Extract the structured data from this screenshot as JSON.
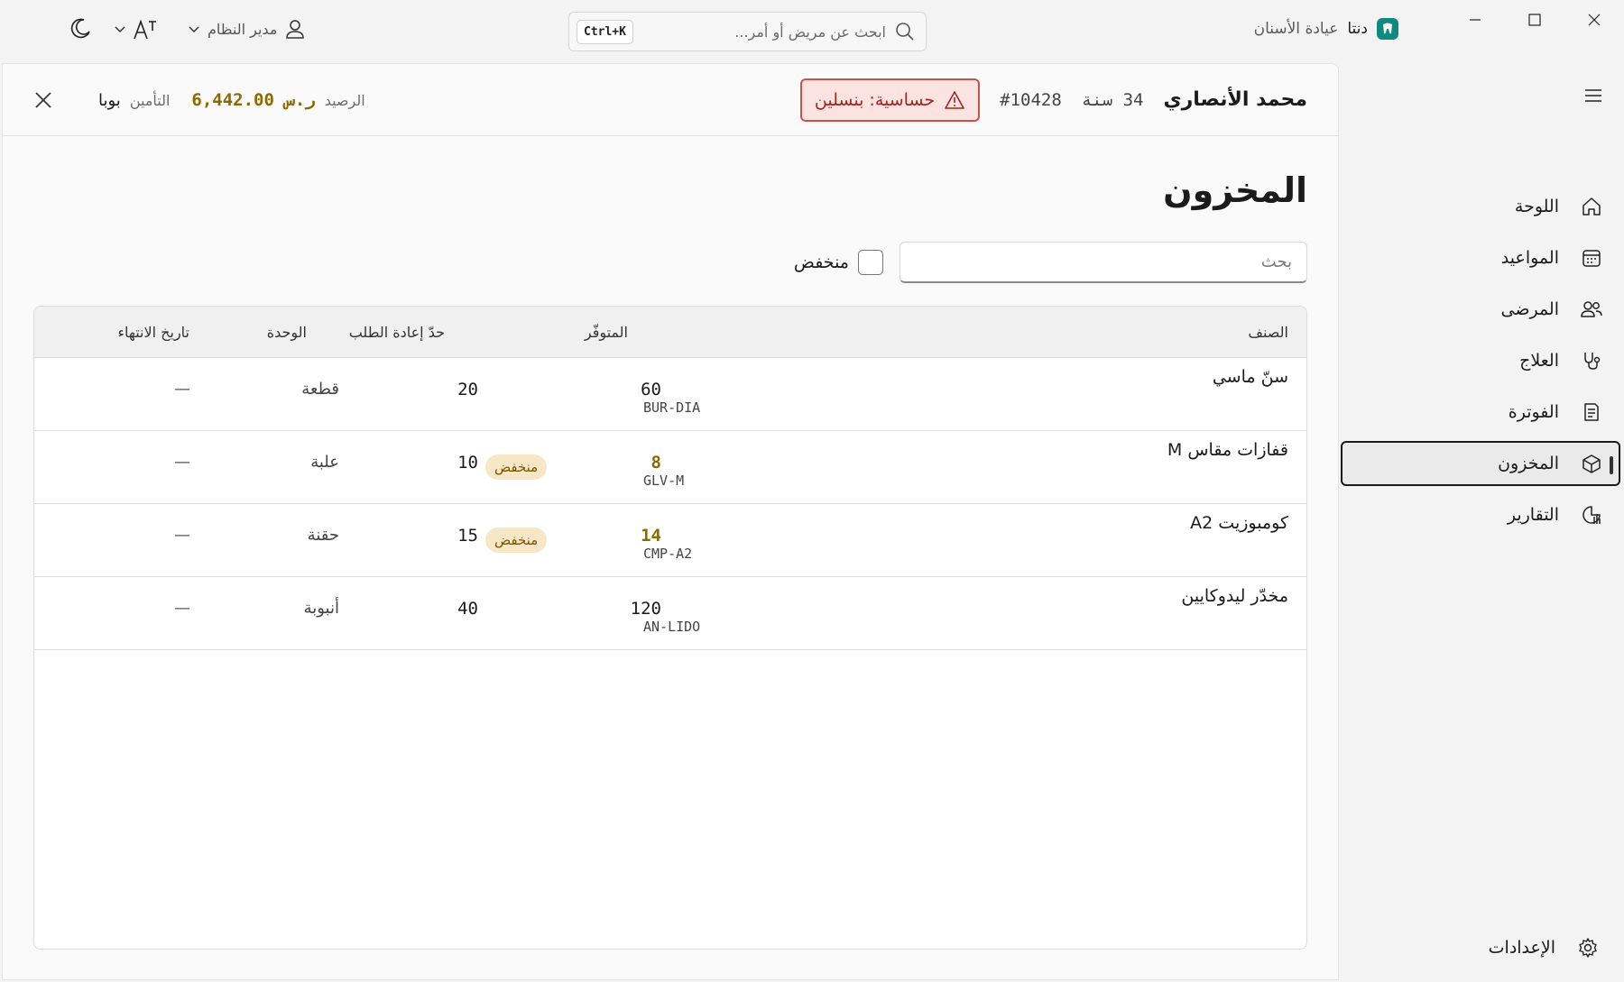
{
  "app": {
    "brand_name": "دنتا",
    "brand_subtitle": "عيادة الأسنان"
  },
  "global_search": {
    "placeholder": "ابحث عن مريض أو أمر...",
    "shortcut": "Ctrl+K"
  },
  "user": {
    "role": "مدير النظام"
  },
  "sidebar": {
    "items": [
      {
        "label": "اللوحة",
        "icon": "home-icon"
      },
      {
        "label": "المواعيد",
        "icon": "calendar-icon"
      },
      {
        "label": "المرضى",
        "icon": "people-icon"
      },
      {
        "label": "العلاج",
        "icon": "stethoscope-icon"
      },
      {
        "label": "الفوترة",
        "icon": "invoice-icon"
      },
      {
        "label": "المخزون",
        "icon": "box-icon",
        "active": true
      },
      {
        "label": "التقارير",
        "icon": "chart-icon"
      }
    ],
    "settings_label": "الإعدادات"
  },
  "patient": {
    "name": "محمد الأنصاري",
    "age": "34 سنة",
    "id": "#10428",
    "allergy": "حساسية: بنسلين",
    "balance_label": "الرصيد",
    "balance_value": "6,442.00 ر.س",
    "insurance_label": "التأمين",
    "insurance_value": "بوبا"
  },
  "page": {
    "title": "المخزون",
    "search_placeholder": "بحث",
    "low_filter_label": "منخفض"
  },
  "table": {
    "headers": {
      "item": "الصنف",
      "available": "المتوفّر",
      "reorder": "حدّ إعادة الطلب",
      "unit": "الوحدة",
      "expiry": "تاريخ الانتهاء"
    },
    "low_badge": "منخفض",
    "rows": [
      {
        "name": "سنّ ماسي",
        "code": "BUR-DIA",
        "available": "60",
        "low": false,
        "reorder": "20",
        "unit": "قطعة",
        "expiry": "—"
      },
      {
        "name": "قفازات مقاس M",
        "code": "GLV-M",
        "available": "8",
        "low": true,
        "reorder": "10",
        "unit": "علبة",
        "expiry": "—"
      },
      {
        "name": "كومبوزيت A2",
        "code": "CMP-A2",
        "available": "14",
        "low": true,
        "reorder": "15",
        "unit": "حقنة",
        "expiry": "—"
      },
      {
        "name": "مخدّر ليدوكايين",
        "code": "AN-LIDO",
        "available": "120",
        "low": false,
        "reorder": "40",
        "unit": "أنبوبة",
        "expiry": "—"
      }
    ]
  },
  "colors": {
    "accent": "#0f8a7e",
    "allergy_border": "#c9534a",
    "allergy_bg": "#fbe3e1",
    "low_text": "#8b6a00",
    "low_badge_bg": "#f8e7c6"
  }
}
